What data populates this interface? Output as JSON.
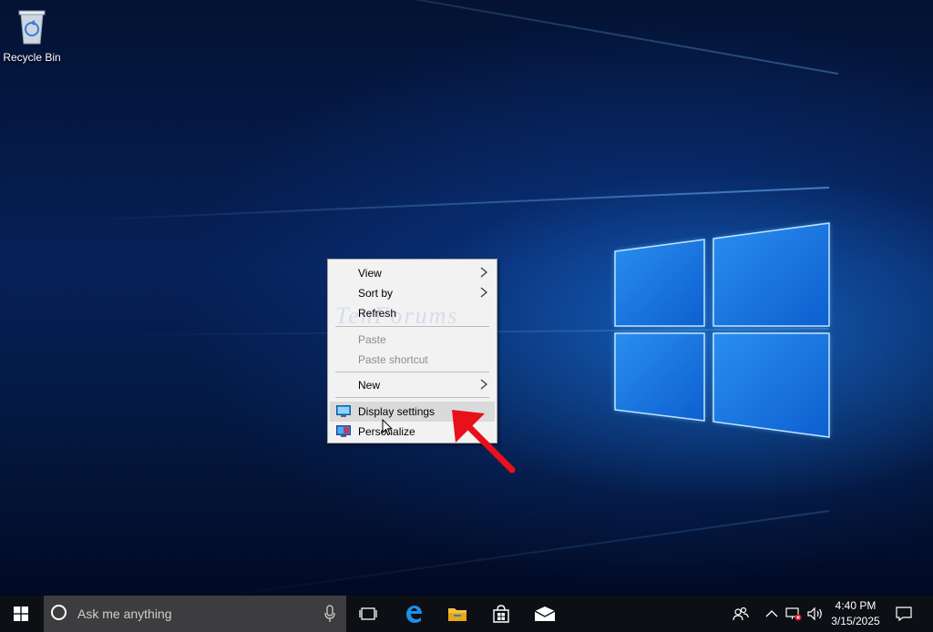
{
  "desktop": {
    "icons": [
      {
        "label": "Recycle Bin",
        "icon": "recycle-bin-icon"
      }
    ],
    "watermark": "TenForums"
  },
  "context_menu": {
    "items": [
      {
        "label": "View",
        "submenu": true,
        "enabled": true
      },
      {
        "label": "Sort by",
        "submenu": true,
        "enabled": true
      },
      {
        "label": "Refresh",
        "submenu": false,
        "enabled": true
      },
      {
        "label": "Paste",
        "submenu": false,
        "enabled": false
      },
      {
        "label": "Paste shortcut",
        "submenu": false,
        "enabled": false
      },
      {
        "label": "New",
        "submenu": true,
        "enabled": true
      },
      {
        "label": "Display settings",
        "submenu": false,
        "enabled": true,
        "icon": "display-icon",
        "highlighted": true
      },
      {
        "label": "Personalize",
        "submenu": false,
        "enabled": true,
        "icon": "personalize-icon"
      }
    ]
  },
  "taskbar": {
    "search_placeholder": "Ask me anything",
    "pinned": [
      "task-view-icon",
      "edge-icon",
      "file-explorer-icon",
      "store-icon",
      "mail-icon"
    ],
    "tray_icons": [
      "people-icon",
      "chevron-up-icon",
      "network-icon",
      "volume-icon"
    ],
    "clock": {
      "time": "4:40 PM",
      "date": "3/15/2025"
    }
  },
  "colors": {
    "accent": "#0078d7",
    "taskbar": "#0c0f14",
    "menu_bg": "#f2f2f2",
    "highlight": "#dadada",
    "arrow": "#e8101b"
  }
}
